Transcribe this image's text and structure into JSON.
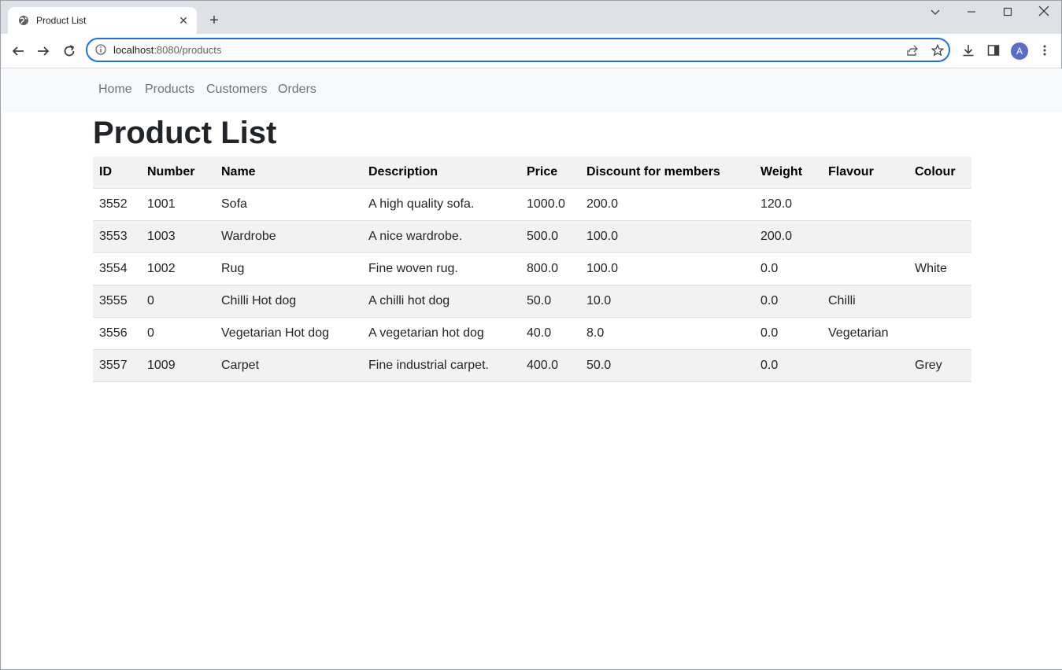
{
  "browser": {
    "tab_title": "Product List",
    "new_tab": "+",
    "url_host": "localhost",
    "url_path": ":8080/products",
    "avatar_initial": "A",
    "accent": "#1a73e8"
  },
  "nav": {
    "links": [
      "Home",
      "Products",
      "Customers",
      "Orders"
    ]
  },
  "page": {
    "title": "Product List"
  },
  "table": {
    "headers": [
      "ID",
      "Number",
      "Name",
      "Description",
      "Price",
      "Discount for members",
      "Weight",
      "Flavour",
      "Colour"
    ],
    "rows": [
      [
        "3552",
        "1001",
        "Sofa",
        "A high quality sofa.",
        "1000.0",
        "200.0",
        "120.0",
        "",
        ""
      ],
      [
        "3553",
        "1003",
        "Wardrobe",
        "A nice wardrobe.",
        "500.0",
        "100.0",
        "200.0",
        "",
        ""
      ],
      [
        "3554",
        "1002",
        "Rug",
        "Fine woven rug.",
        "800.0",
        "100.0",
        "0.0",
        "",
        "White"
      ],
      [
        "3555",
        "0",
        "Chilli Hot dog",
        "A chilli hot dog",
        "50.0",
        "10.0",
        "0.0",
        "Chilli",
        ""
      ],
      [
        "3556",
        "0",
        "Vegetarian Hot dog",
        "A vegetarian hot dog",
        "40.0",
        "8.0",
        "0.0",
        "Vegetarian",
        ""
      ],
      [
        "3557",
        "1009",
        "Carpet",
        "Fine industrial carpet.",
        "400.0",
        "50.0",
        "0.0",
        "",
        "Grey"
      ]
    ]
  }
}
